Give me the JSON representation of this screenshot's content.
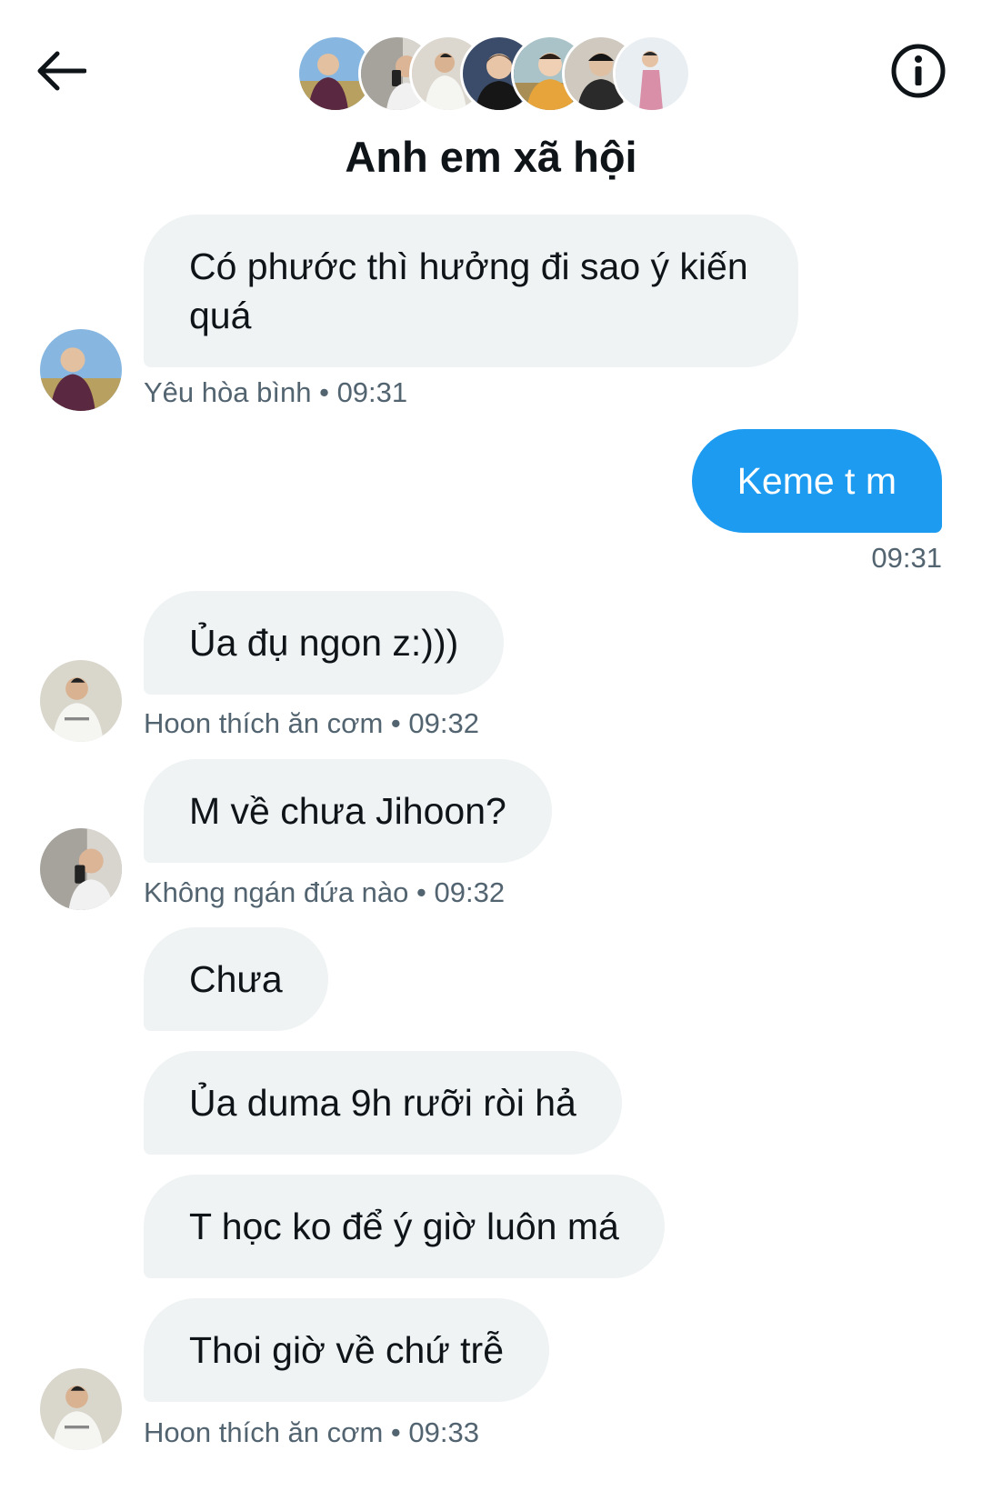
{
  "header": {
    "title": "Anh em xã hội",
    "back_icon": "arrow-left-icon",
    "info_icon": "info-circle-icon",
    "participant_count_shown": 7
  },
  "messages": [
    {
      "side": "left",
      "text": "Có phước thì hưởng đi sao ý kiến quá",
      "sender": "Yêu hòa bình",
      "time": "09:31"
    },
    {
      "side": "right",
      "text": "Keme t m",
      "time": "09:31"
    },
    {
      "side": "left",
      "text": "Ủa đụ ngon z:)))",
      "sender": "Hoon thích ăn cơm",
      "time": "09:32"
    },
    {
      "side": "left",
      "text": "M về chưa Jihoon?",
      "sender": "Không ngán đứa nào",
      "time": "09:32"
    },
    {
      "side": "left",
      "text": "Chưa"
    },
    {
      "side": "left",
      "text": "Ủa duma 9h rưỡi ròi hả"
    },
    {
      "side": "left",
      "text": "T học ko để ý giờ luôn má"
    },
    {
      "side": "left",
      "text": "Thoi giờ về chứ trễ",
      "sender": "Hoon thích ăn cơm",
      "time": "09:33"
    }
  ],
  "separator": "•",
  "colors": {
    "accent": "#1d9bf0",
    "bubble_received": "#eff3f4",
    "text_primary": "#0f1419",
    "text_secondary": "#536471"
  }
}
